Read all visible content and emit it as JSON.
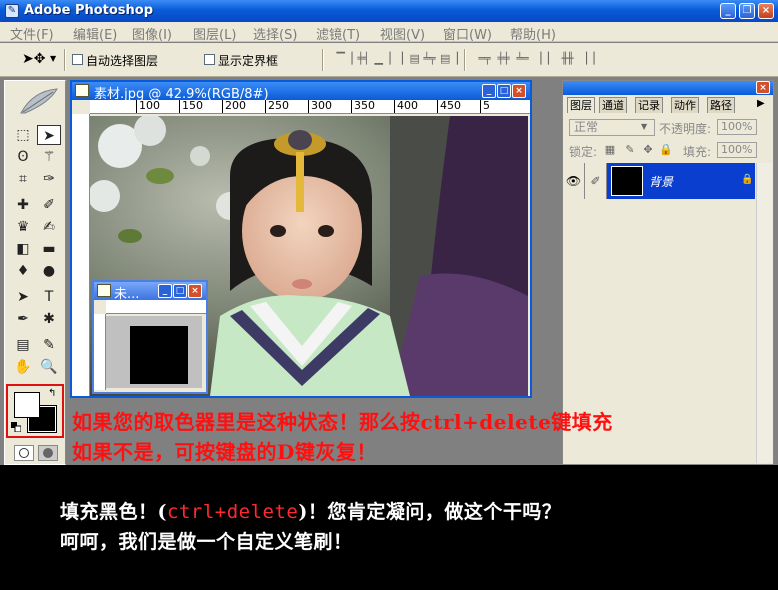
{
  "window": {
    "title": "Adobe Photoshop"
  },
  "menu": [
    "文件(F)",
    "编辑(E)",
    "图像(I)",
    "图层(L)",
    "选择(S)",
    "滤镜(T)",
    "视图(V)",
    "窗口(W)",
    "帮助(H)"
  ],
  "options": {
    "auto_select_label": "自动选择图层",
    "show_bounds_label": "显示定界框"
  },
  "document": {
    "title": "素材.jpg @ 42.9%(RGB/8#)",
    "ruler_ticks": [
      "100",
      "150",
      "200",
      "250",
      "300",
      "350",
      "400",
      "450",
      "5"
    ]
  },
  "small_document": {
    "title": "未..."
  },
  "layers_panel": {
    "tabs": [
      "图层",
      "通道",
      "记录",
      "动作",
      "路径"
    ],
    "blend_mode": "正常",
    "opacity_label": "不透明度:",
    "opacity_value": "100%",
    "lock_label": "锁定:",
    "fill_label": "填充:",
    "fill_value": "100%",
    "layer_name": "背景"
  },
  "notes": {
    "line1": "如果您的取色器里是这种状态！那么按ctrl+delete键填充",
    "line2": "如果不是，可按键盘的D键灰复！"
  },
  "caption": {
    "line1_pre": "填充黑色！(",
    "line1_key": "ctrl+delete",
    "line1_post": ")！您肯定凝问，做这个干吗？",
    "line2": "呵呵，我们是做一个自定义笔刷！"
  },
  "colors": {
    "foreground": "#ffffff",
    "background": "#000000",
    "highlight": "#e01010",
    "xp_blue": "#0a5bd9"
  }
}
